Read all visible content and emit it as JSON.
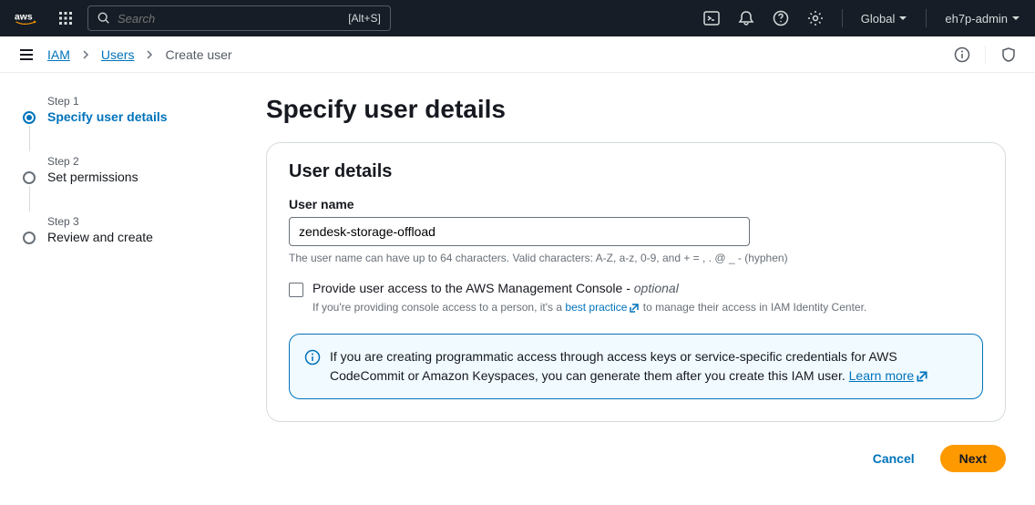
{
  "nav": {
    "search_placeholder": "Search",
    "search_shortcut": "[Alt+S]",
    "region": "Global",
    "account": "eh7p-admin"
  },
  "breadcrumbs": {
    "root": "IAM",
    "parent": "Users",
    "current": "Create user"
  },
  "stepper": {
    "steps": [
      {
        "label": "Step 1",
        "title": "Specify user details"
      },
      {
        "label": "Step 2",
        "title": "Set permissions"
      },
      {
        "label": "Step 3",
        "title": "Review and create"
      }
    ]
  },
  "content": {
    "page_title": "Specify user details",
    "panel_title": "User details",
    "username_label": "User name",
    "username_value": "zendesk-storage-offload",
    "username_hint": "The user name can have up to 64 characters. Valid characters: A-Z, a-z, 0-9, and + = , . @ _ - (hyphen)",
    "console_access_label": "Provide user access to the AWS Management Console - ",
    "optional": "optional",
    "console_hint_prefix": "If you're providing console access to a person, it's a ",
    "console_hint_link": "best practice",
    "console_hint_suffix": " to manage their access in IAM Identity Center.",
    "info_text": "If you are creating programmatic access through access keys or service-specific credentials for AWS CodeCommit or Amazon Keyspaces, you can generate them after you create this IAM user. ",
    "learn_more": "Learn more"
  },
  "actions": {
    "cancel": "Cancel",
    "next": "Next"
  }
}
